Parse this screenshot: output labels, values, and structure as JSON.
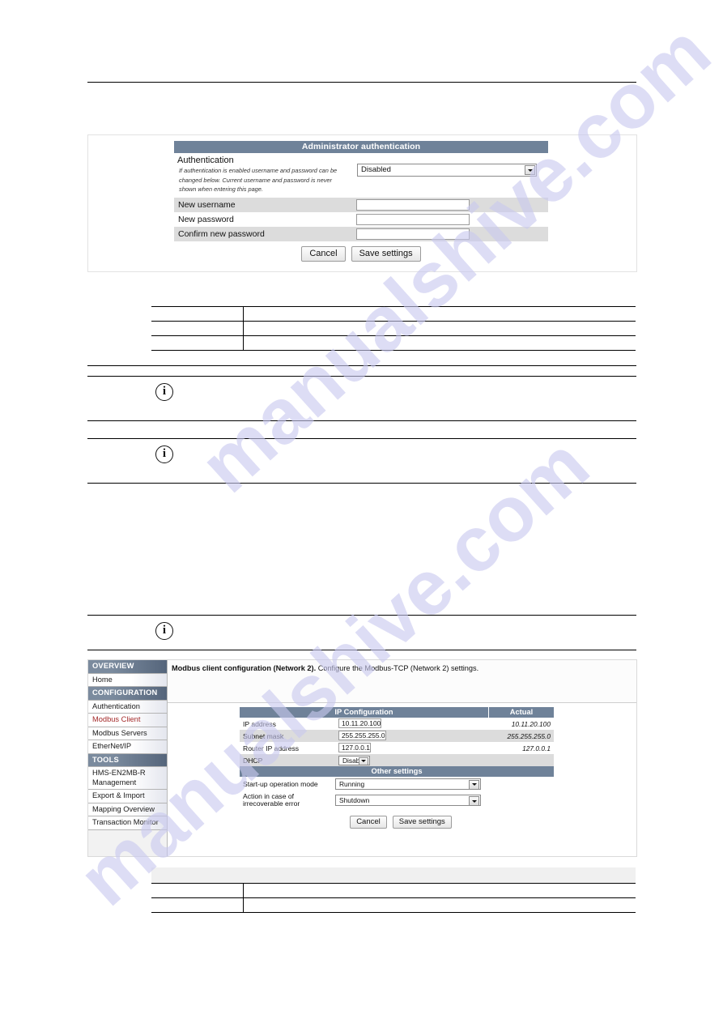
{
  "watermark": {
    "text": "manualshive.com"
  },
  "auth_screenshot": {
    "panel_title": "Administrator authentication",
    "section_heading": "Authentication",
    "section_description": "If authentication is enabled username and password can be changed below. Current username and password is never shown when entering this page.",
    "auth_select_value": "Disabled",
    "fields": [
      {
        "label": "New username",
        "value": ""
      },
      {
        "label": "New password",
        "value": ""
      },
      {
        "label": "Confirm new password",
        "value": ""
      }
    ],
    "cancel_label": "Cancel",
    "save_label": "Save settings"
  },
  "modbus_screenshot": {
    "sidebar": [
      {
        "label": "OVERVIEW",
        "type": "header"
      },
      {
        "label": "Home",
        "type": "item"
      },
      {
        "label": "CONFIGURATION",
        "type": "header"
      },
      {
        "label": "Authentication",
        "type": "item"
      },
      {
        "label": "Modbus Client",
        "type": "item",
        "active": true
      },
      {
        "label": "Modbus Servers",
        "type": "item"
      },
      {
        "label": "EtherNet/IP",
        "type": "item"
      },
      {
        "label": "TOOLS",
        "type": "header"
      },
      {
        "label": "HMS-EN2MB-R Management",
        "type": "item"
      },
      {
        "label": "Export & Import",
        "type": "item"
      },
      {
        "label": "Mapping Overview",
        "type": "item"
      },
      {
        "label": "Transaction Monitor",
        "type": "item"
      }
    ],
    "page_title": "Modbus client configuration (Network 2).",
    "page_subtitle": "Configure the Modbus-TCP (Network 2) settings.",
    "ip_section_title": "IP Configuration",
    "actual_col_title": "Actual",
    "ip_rows": [
      {
        "label": "IP address",
        "value": "10.11.20.100",
        "actual": "10.11.20.100"
      },
      {
        "label": "Subnet mask",
        "value": "255.255.255.0",
        "actual": "255.255.255.0"
      },
      {
        "label": "Router IP address",
        "value": "127.0.0.1",
        "actual": "127.0.0.1"
      }
    ],
    "dhcp_label": "DHCP",
    "dhcp_value": "Disabled",
    "other_section_title": "Other settings",
    "startup_label": "Start-up operation mode",
    "startup_value": "Running",
    "error_action_label": "Action in case of irrecoverable error",
    "error_action_value": "Shutdown",
    "cancel_label": "Cancel",
    "save_label": "Save settings"
  },
  "icons": {
    "info": "i",
    "dropdown": "chevron-down-icon"
  },
  "colors": {
    "panel_header": "#6f8299",
    "row_alt": "#dcdcdc",
    "active_nav": "#a42a2a",
    "watermark": "#c9c9ef"
  }
}
